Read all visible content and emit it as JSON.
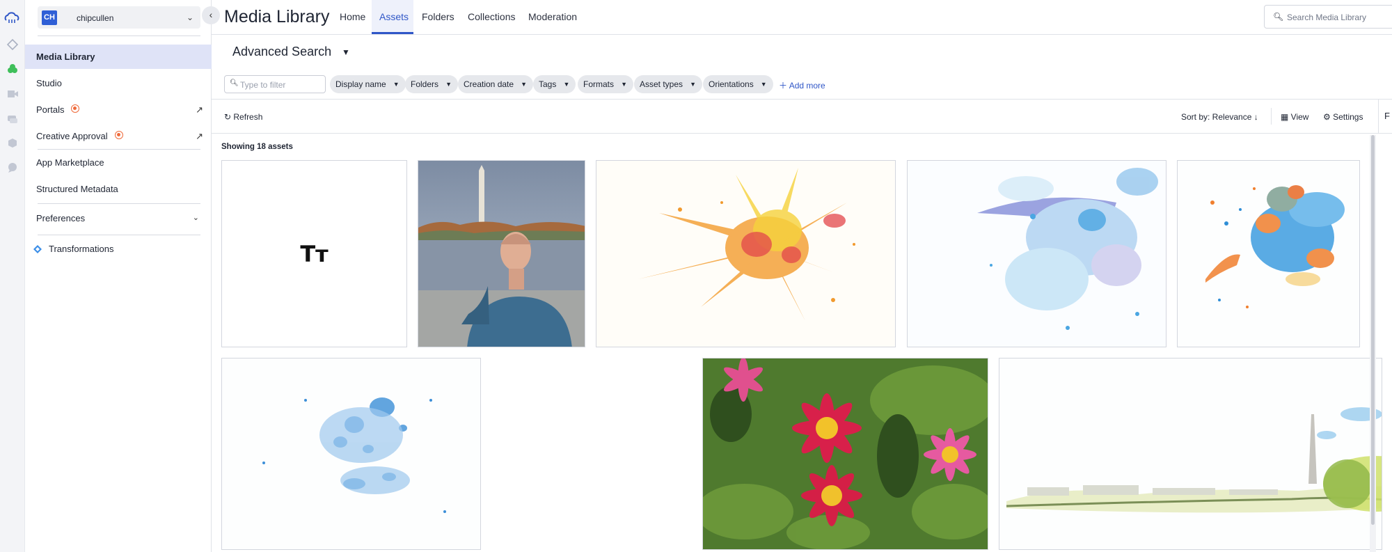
{
  "account": {
    "initials": "CH",
    "name": "chipcullen"
  },
  "sidebar": {
    "items": [
      {
        "label": "Media Library"
      },
      {
        "label": "Studio"
      },
      {
        "label": "Portals"
      },
      {
        "label": "Creative Approval"
      },
      {
        "label": "App Marketplace"
      },
      {
        "label": "Structured Metadata"
      },
      {
        "label": "Preferences"
      },
      {
        "label": "Transformations"
      }
    ]
  },
  "header": {
    "title": "Media Library",
    "tabs": [
      {
        "label": "Home"
      },
      {
        "label": "Assets"
      },
      {
        "label": "Folders"
      },
      {
        "label": "Collections"
      },
      {
        "label": "Moderation"
      }
    ],
    "search_placeholder": "Search Media Library"
  },
  "search": {
    "mode": "Advanced Search",
    "filter_placeholder": "Type to filter",
    "filters": [
      "Display name",
      "Folders",
      "Creation date",
      "Tags",
      "Formats",
      "Asset types",
      "Orientations"
    ],
    "add_more": "Add more"
  },
  "toolbar": {
    "refresh": "Refresh",
    "sort": "Sort by: Relevance",
    "view": "View",
    "settings": "Settings",
    "right_edge": "F"
  },
  "results": {
    "count_label": "Showing 18 assets",
    "font_glyph": "Tт"
  },
  "colors": {
    "accent": "#2f56c7",
    "active_bg": "#dfe3f7",
    "badge": "#ef6a3a"
  }
}
